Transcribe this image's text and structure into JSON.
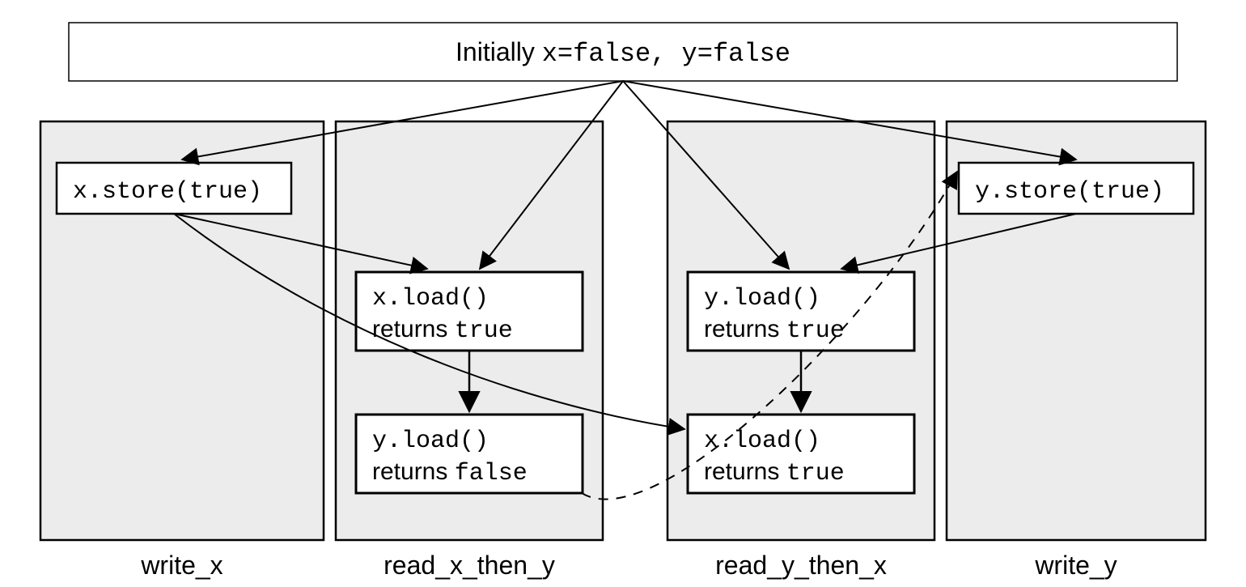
{
  "header": {
    "prefix": "Initially ",
    "code": "x=false, y=false"
  },
  "threads": [
    {
      "label": "write_x"
    },
    {
      "label": "read_x_then_y"
    },
    {
      "label": "write_y"
    },
    {
      "label": "read_y_then_x"
    }
  ],
  "ops": {
    "x_store": "x.store(true)",
    "y_store": "y.store(true)",
    "x_load": "x.load()",
    "y_load": "y.load()",
    "returns_word": "returns ",
    "true": "true",
    "false": "false"
  }
}
